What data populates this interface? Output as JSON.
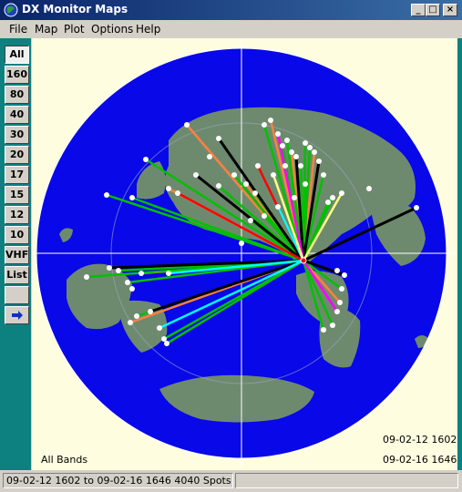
{
  "window": {
    "title": "DX Monitor Maps",
    "controls": {
      "minimize": "_",
      "maximize": "□",
      "close": "×"
    }
  },
  "menu": [
    "File",
    "Map",
    "Plot",
    "Options",
    "Help"
  ],
  "bands": [
    "All",
    "160",
    "80",
    "40",
    "30",
    "20",
    "17",
    "15",
    "12",
    "10",
    "VHF",
    "List"
  ],
  "active_band": "All",
  "next_icon": "arrow-right-icon",
  "map": {
    "band_label": "All Bands",
    "time_start": "09-02-12 1602",
    "time_end": "09-02-16 1646",
    "colors": {
      "ocean": "#0808e8",
      "land": "#6e8a6e",
      "background": "#fffde0"
    },
    "paths": [
      {
        "color": "#ff8040",
        "count": 10
      },
      {
        "color": "#00c000",
        "count": 28
      },
      {
        "color": "#000000",
        "count": 8
      },
      {
        "color": "#ff0000",
        "count": 2
      },
      {
        "color": "#00ffff",
        "count": 3
      },
      {
        "color": "#ff00ff",
        "count": 2
      },
      {
        "color": "#ffff80",
        "count": 2
      }
    ]
  },
  "status": "09-02-12 1602 to 09-02-16 1646 4040 Spots"
}
